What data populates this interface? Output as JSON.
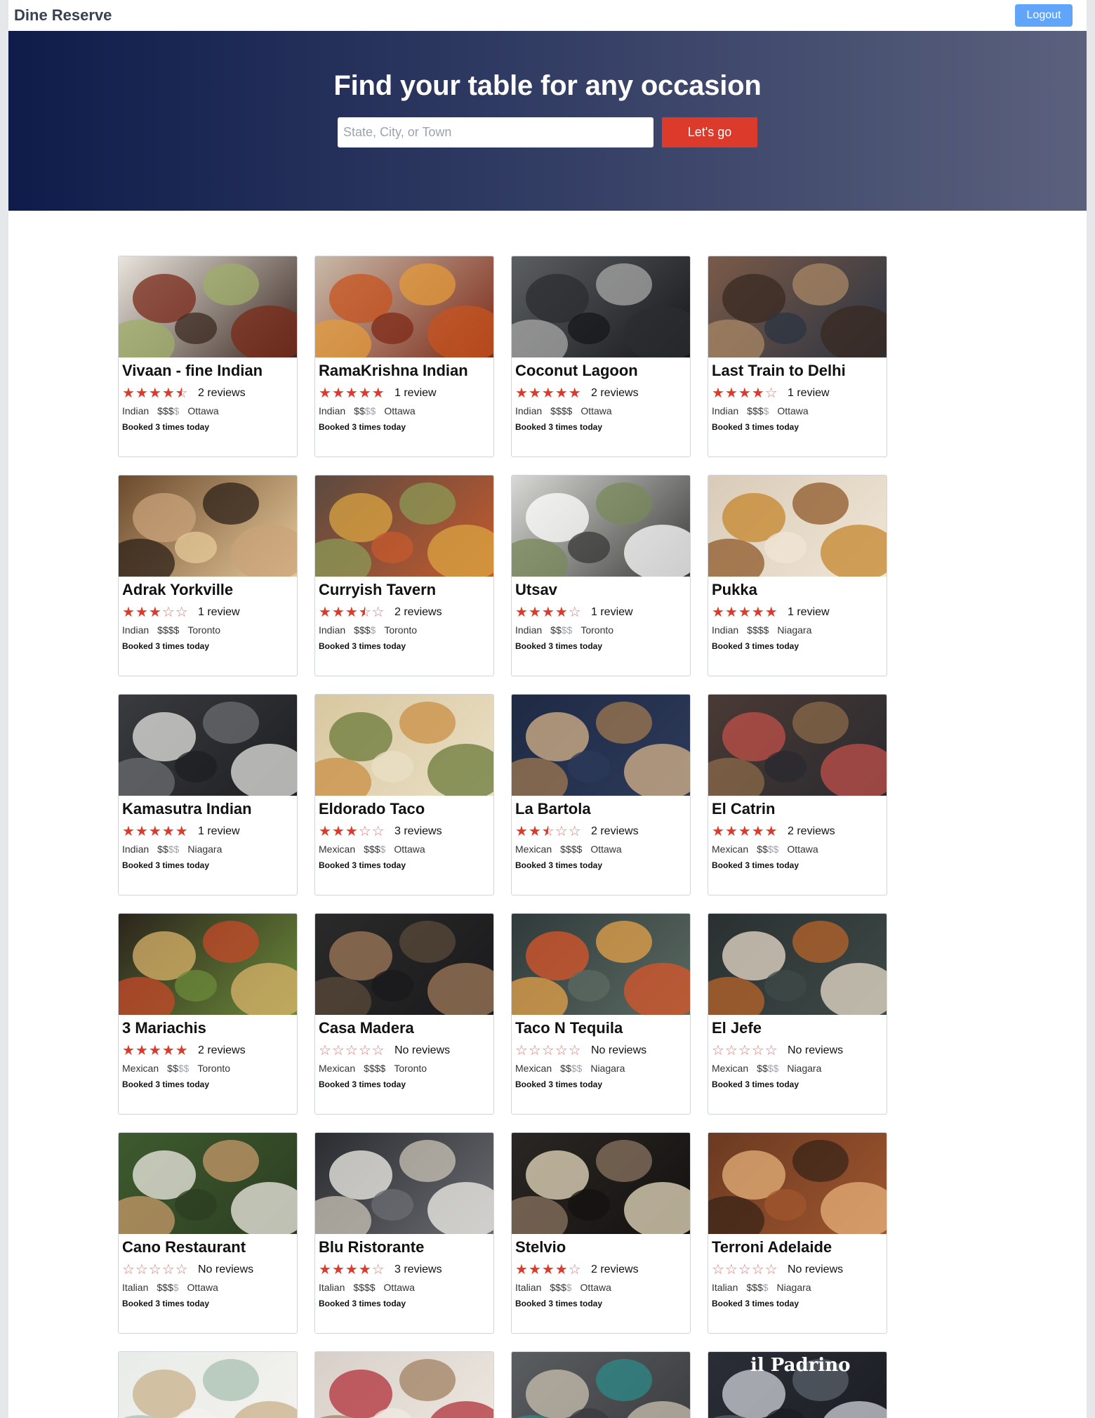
{
  "app": {
    "brand": "Dine Reserve",
    "logout_label": "Logout"
  },
  "hero": {
    "title": "Find your table for any occasion",
    "search_placeholder": "State, City, or Town",
    "search_value": "",
    "go_label": "Let's go"
  },
  "colors": {
    "accent_red": "#dc3b2b",
    "logout_blue": "#60a5fa",
    "hero_start": "#0f1c4a",
    "hero_end": "#5b617d"
  },
  "restaurants": [
    {
      "name": "Vivaan - fine Indian",
      "rating": 4.5,
      "reviews": "2 reviews",
      "cuisine": "Indian",
      "price": 3,
      "city": "Ottawa",
      "booked": "Booked 3 times today",
      "image": "food-plate"
    },
    {
      "name": "RamaKrishna Indian",
      "rating": 5,
      "reviews": "1 review",
      "cuisine": "Indian",
      "price": 2,
      "city": "Ottawa",
      "booked": "Booked 3 times today",
      "image": "curry-dishes"
    },
    {
      "name": "Coconut Lagoon",
      "rating": 5,
      "reviews": "2 reviews",
      "cuisine": "Indian",
      "price": 4,
      "city": "Ottawa",
      "booked": "Booked 3 times today",
      "image": "modern-interior"
    },
    {
      "name": "Last Train to Delhi",
      "rating": 4,
      "reviews": "1 review",
      "cuisine": "Indian",
      "price": 3,
      "city": "Ottawa",
      "booked": "Booked 3 times today",
      "image": "brick-dining-room"
    },
    {
      "name": "Adrak Yorkville",
      "rating": 3,
      "reviews": "1 review",
      "cuisine": "Indian",
      "price": 4,
      "city": "Toronto",
      "booked": "Booked 3 times today",
      "image": "lounge-interior"
    },
    {
      "name": "Curryish Tavern",
      "rating": 3.5,
      "reviews": "2 reviews",
      "cuisine": "Indian",
      "price": 3,
      "city": "Toronto",
      "booked": "Booked 3 times today",
      "image": "many-bowls"
    },
    {
      "name": "Utsav",
      "rating": 4,
      "reviews": "1 review",
      "cuisine": "Indian",
      "price": 2,
      "city": "Toronto",
      "booked": "Booked 3 times today",
      "image": "table-setting"
    },
    {
      "name": "Pukka",
      "rating": 5,
      "reviews": "1 review",
      "cuisine": "Indian",
      "price": 4,
      "city": "Niagara",
      "booked": "Booked 3 times today",
      "image": "shared-plates"
    },
    {
      "name": "Kamasutra Indian",
      "rating": 5,
      "reviews": "1 review",
      "cuisine": "Indian",
      "price": 2,
      "city": "Niagara",
      "booked": "Booked 3 times today",
      "image": "banquet-hall"
    },
    {
      "name": "Eldorado Taco",
      "rating": 3,
      "reviews": "3 reviews",
      "cuisine": "Mexican",
      "price": 3,
      "city": "Ottawa",
      "booked": "Booked 3 times today",
      "image": "tacos"
    },
    {
      "name": "La Bartola",
      "rating": 2.5,
      "reviews": "2 reviews",
      "cuisine": "Mexican",
      "price": 4,
      "city": "Ottawa",
      "booked": "Booked 3 times today",
      "image": "lattice-wall"
    },
    {
      "name": "El Catrin",
      "rating": 5,
      "reviews": "2 reviews",
      "cuisine": "Mexican",
      "price": 2,
      "city": "Ottawa",
      "booked": "Booked 3 times today",
      "image": "mural-patio"
    },
    {
      "name": "3 Mariachis",
      "rating": 5,
      "reviews": "2 reviews",
      "cuisine": "Mexican",
      "price": 2,
      "city": "Toronto",
      "booked": "Booked 3 times today",
      "image": "mexican-spread"
    },
    {
      "name": "Casa Madera",
      "rating": 0,
      "reviews": "No reviews",
      "cuisine": "Mexican",
      "price": 4,
      "city": "Toronto",
      "booked": "Booked 3 times today",
      "image": "dark-dining-room"
    },
    {
      "name": "Taco N Tequila",
      "rating": 0,
      "reviews": "No reviews",
      "cuisine": "Mexican",
      "price": 2,
      "city": "Niagara",
      "booked": "Booked 3 times today",
      "image": "sugar-skull"
    },
    {
      "name": "El Jefe",
      "rating": 0,
      "reviews": "No reviews",
      "cuisine": "Mexican",
      "price": 2,
      "city": "Niagara",
      "booked": "Booked 3 times today",
      "image": "burrito"
    },
    {
      "name": "Cano Restaurant",
      "rating": 0,
      "reviews": "No reviews",
      "cuisine": "Italian",
      "price": 3,
      "city": "Ottawa",
      "booked": "Booked 3 times today",
      "image": "green-wall-terrace"
    },
    {
      "name": "Blu Ristorante",
      "rating": 4,
      "reviews": "3 reviews",
      "cuisine": "Italian",
      "price": 4,
      "city": "Ottawa",
      "booked": "Booked 3 times today",
      "image": "wine-glasses"
    },
    {
      "name": "Stelvio",
      "rating": 4,
      "reviews": "2 reviews",
      "cuisine": "Italian",
      "price": 3,
      "city": "Ottawa",
      "booked": "Booked 3 times today",
      "image": "risotto-dish"
    },
    {
      "name": "Terroni Adelaide",
      "rating": 0,
      "reviews": "No reviews",
      "cuisine": "Italian",
      "price": 3,
      "city": "Niagara",
      "booked": "Booked 3 times today",
      "image": "warm-bistro"
    }
  ],
  "partial_row": [
    {
      "image": "bright-cafe"
    },
    {
      "image": "red-chairs-room"
    },
    {
      "image": "patterned-interior"
    },
    {
      "image": "il-padrino-storefront",
      "sign_text": "il Padrino"
    }
  ]
}
